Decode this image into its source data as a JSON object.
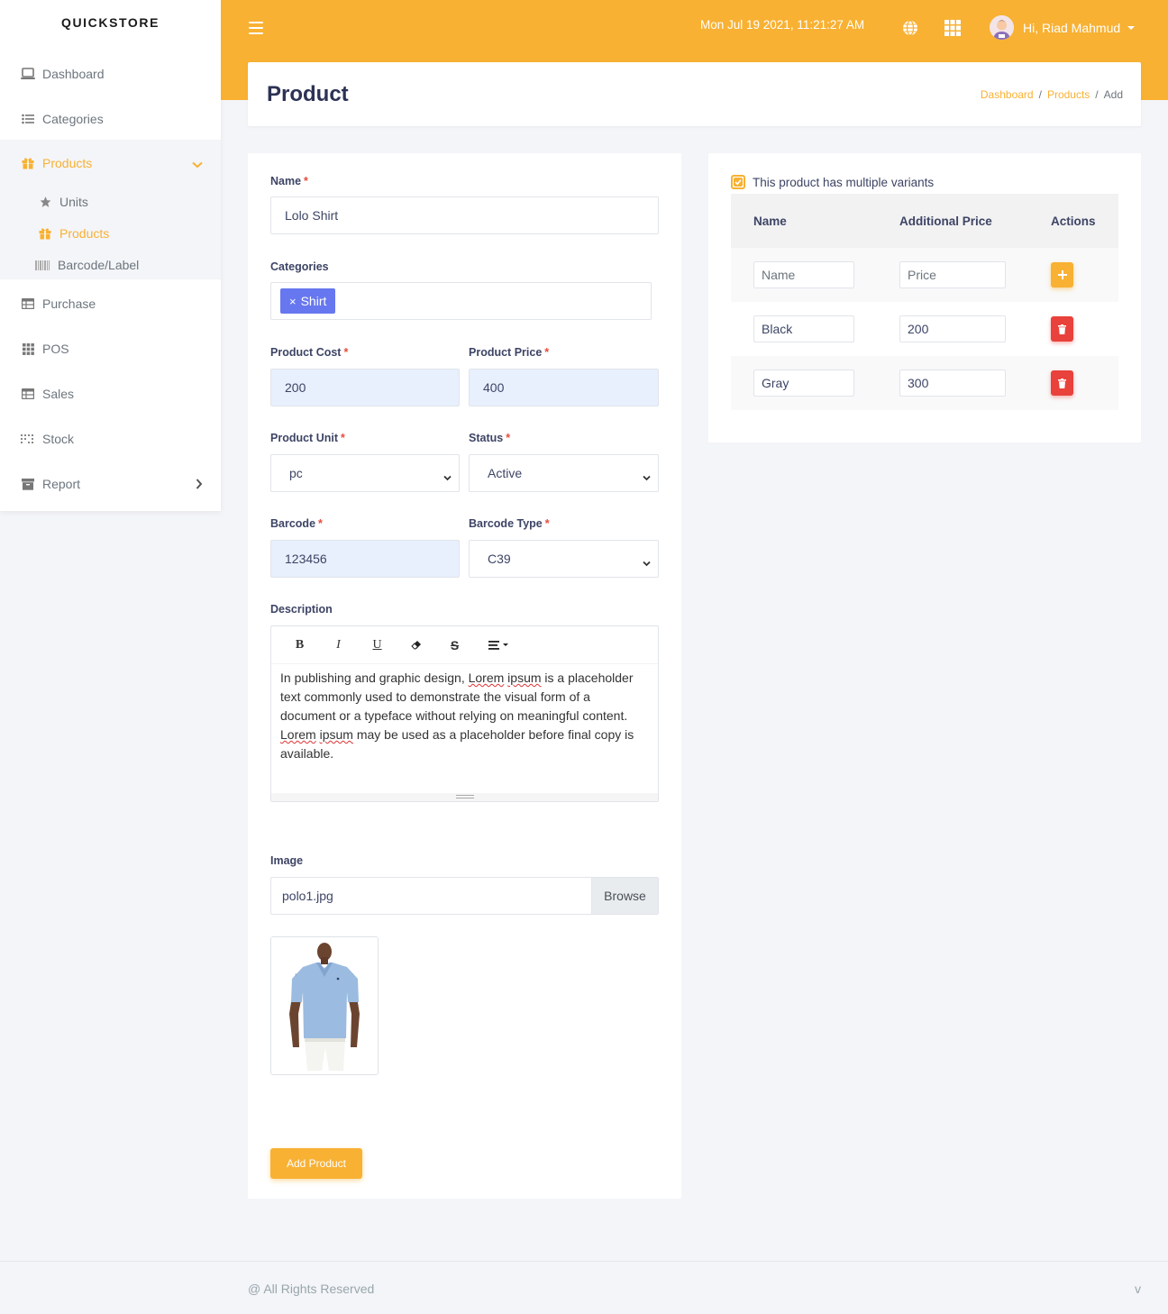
{
  "brand": "QUICKSTORE",
  "sidebar": {
    "items": [
      {
        "label": "Dashboard",
        "icon": "laptop-icon"
      },
      {
        "label": "Categories",
        "icon": "list-icon"
      },
      {
        "label": "Products",
        "icon": "gift-icon"
      },
      {
        "label": "Purchase",
        "icon": "table-icon"
      },
      {
        "label": "POS",
        "icon": "grid-icon"
      },
      {
        "label": "Sales",
        "icon": "table-icon"
      },
      {
        "label": "Stock",
        "icon": "dots-grid-icon"
      },
      {
        "label": "Report",
        "icon": "archive-icon"
      }
    ],
    "sub_items": [
      {
        "label": "Units",
        "icon": "star-icon"
      },
      {
        "label": "Products",
        "icon": "gift-icon"
      },
      {
        "label": "Barcode/Label",
        "icon": "barcode-icon"
      }
    ]
  },
  "header": {
    "datetime": "Mon Jul 19 2021, 11:21:27 AM",
    "user_greeting": "Hi, Riad Mahmud"
  },
  "page": {
    "title": "Product",
    "breadcrumb": [
      "Dashboard",
      "Products",
      "Add"
    ]
  },
  "form": {
    "name_label": "Name",
    "name_value": "Lolo Shirt",
    "categories_label": "Categories",
    "category_tag": "Shirt",
    "cost_label": "Product Cost",
    "cost_value": "200",
    "price_label": "Product Price",
    "price_value": "400",
    "unit_label": "Product Unit",
    "unit_value": "pc",
    "status_label": "Status",
    "status_value": "Active",
    "barcode_label": "Barcode",
    "barcode_value": "123456",
    "barcode_type_label": "Barcode Type",
    "barcode_type_value": "C39",
    "description_label": "Description",
    "description_parts": [
      "In publishing and graphic design, ",
      "Lorem",
      " ",
      "ipsum",
      " is a placeholder text commonly used to demonstrate the visual form of a document or a typeface without relying on meaningful content. ",
      "Lorem",
      " ",
      "ipsum",
      " may be used as a placeholder before final copy is available."
    ],
    "image_label": "Image",
    "image_file": "polo1.jpg",
    "browse_label": "Browse",
    "submit_label": "Add Product",
    "required_mark": "*"
  },
  "variants": {
    "checkbox_label": "This product has multiple variants",
    "columns": [
      "Name",
      "Additional Price",
      "Actions"
    ],
    "new_row": {
      "name_placeholder": "Name",
      "price_placeholder": "Price"
    },
    "rows": [
      {
        "name": "Black",
        "price": "200"
      },
      {
        "name": "Gray",
        "price": "300"
      }
    ]
  },
  "footer": {
    "text": "@ All Rights Reserved",
    "version": "v"
  },
  "colors": {
    "accent": "#f8b133",
    "tag": "#6777ef",
    "danger": "#e9413b"
  }
}
